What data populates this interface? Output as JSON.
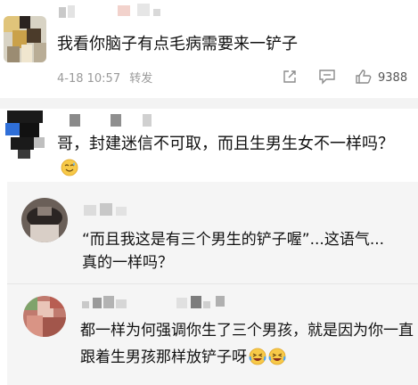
{
  "comments": [
    {
      "text": "我看你脑子有点毛病需要来一铲子",
      "timestamp": "4-18 10:57",
      "repost_label": "转发",
      "likes": "9388",
      "icons": [
        "share-icon",
        "comment-icon",
        "like-icon"
      ]
    },
    {
      "text": "哥，封建迷信不可取，而且生男生女不一样吗？",
      "emoji": "sweat-smile-emoji"
    }
  ],
  "replies": [
    {
      "text": "“而且我这是有三个男生的铲子喔”...这语气... 真的一样吗？"
    },
    {
      "text": "都一样为何强调你生了三个男孩，就是因为你一直跟着生男孩那样放铲子呀",
      "emojis": [
        "laughing-tears-emoji",
        "laughing-tears-emoji"
      ]
    }
  ],
  "colors": {
    "text": "#111111",
    "meta": "#9a9a9a",
    "reply_bg": "#f5f5f5",
    "separator": "#f3f3f3"
  }
}
